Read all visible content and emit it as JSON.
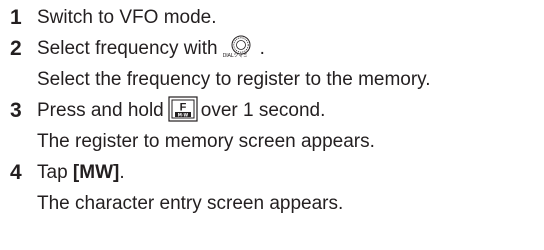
{
  "steps": [
    {
      "number": "1",
      "text": "Switch to VFO mode."
    },
    {
      "number": "2",
      "text_before": "Select frequency with",
      "icon": "dial-knob-icon",
      "icon_label": "DIALツマミ",
      "text_after": ".",
      "note": "Select the frequency to register to the memory."
    },
    {
      "number": "3",
      "text_before": "Press and hold",
      "icon": "f-mw-key-icon",
      "key_top": "F",
      "key_bottom": "M·W",
      "text_after": "over 1 second.",
      "note": "The register to memory screen appears."
    },
    {
      "number": "4",
      "text_before": "Tap",
      "keyword": "[MW]",
      "text_after": ".",
      "note": "The character entry screen appears."
    }
  ]
}
